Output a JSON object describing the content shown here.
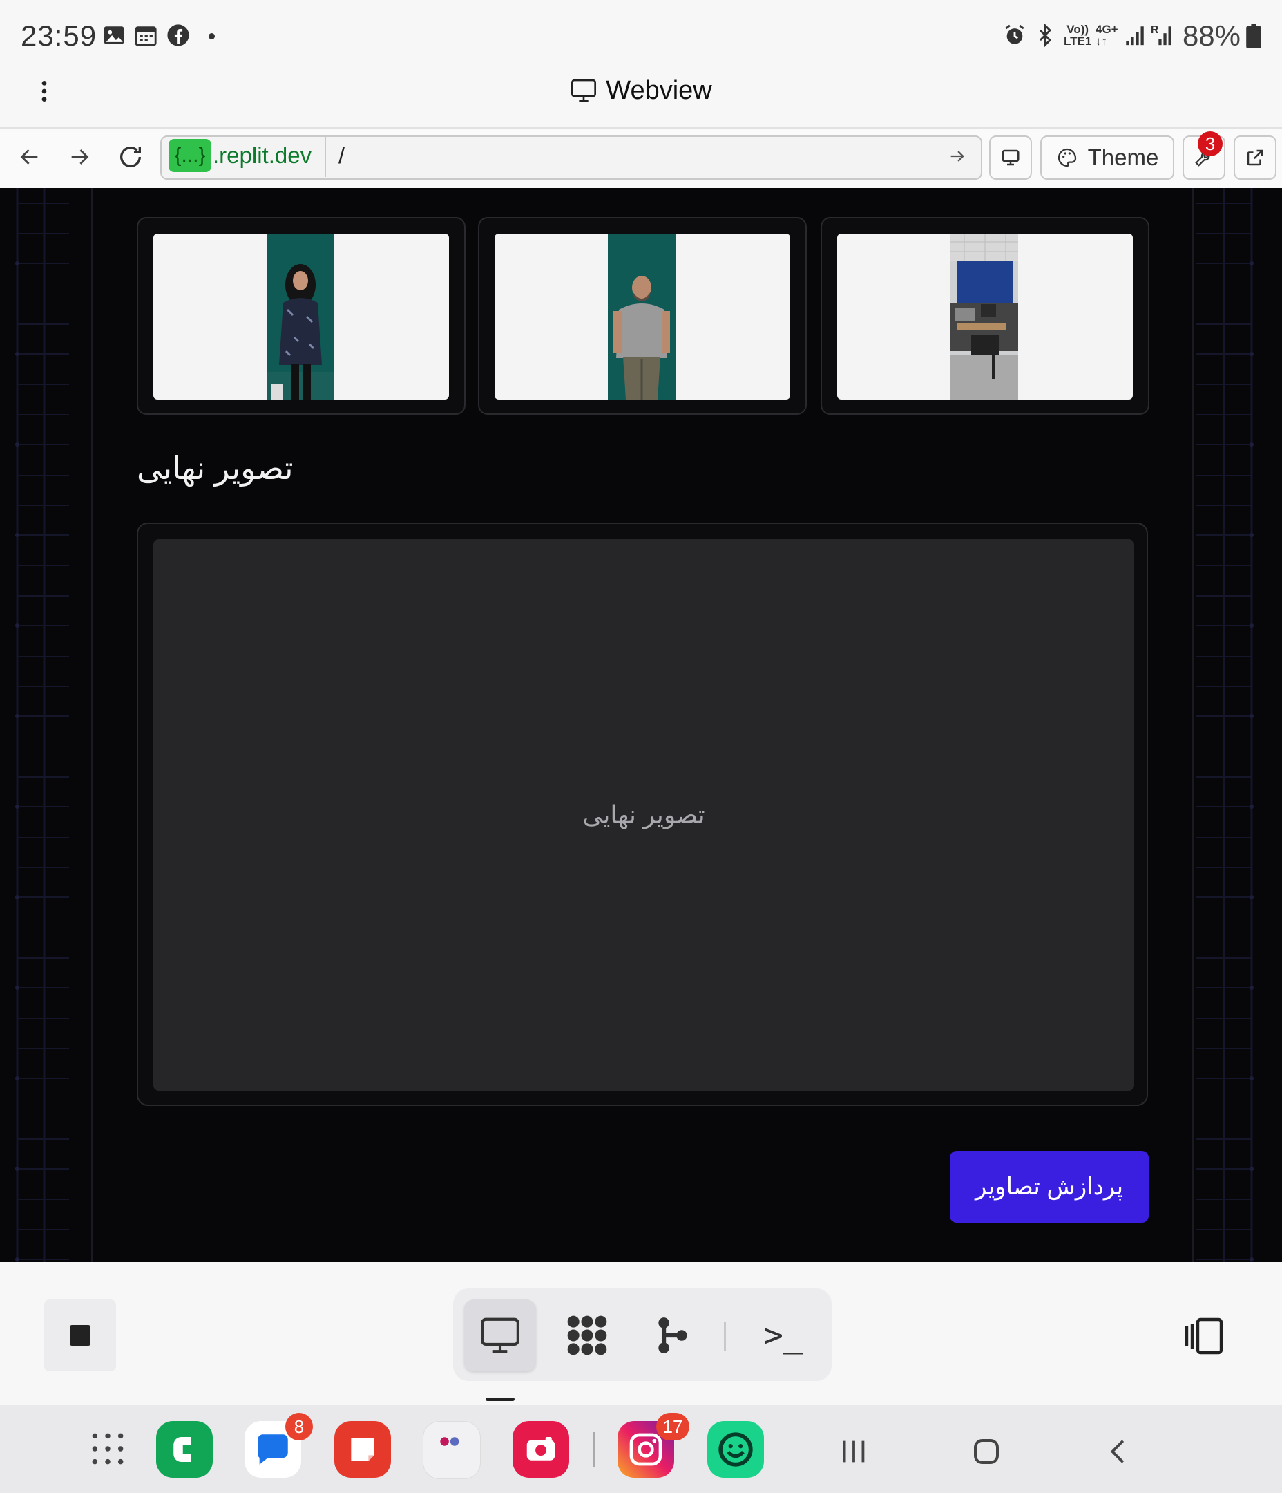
{
  "status_bar": {
    "time": "23:59",
    "battery": "88%",
    "left_icons": [
      "gallery-icon",
      "calendar-icon",
      "facebook-icon",
      "dot-icon"
    ],
    "right_icons": [
      "alarm-icon",
      "bluetooth-icon",
      "volte-icon",
      "4g-icon",
      "signal-icon",
      "signal-roaming-icon",
      "battery-icon"
    ],
    "volte_top": "Vo))",
    "volte_bottom": "LTE1",
    "net_type": "4G+",
    "roaming_mark": "R"
  },
  "title_bar": {
    "title": "Webview",
    "menu_icon": "more-vert-icon",
    "title_icon": "monitor-icon"
  },
  "url_bar": {
    "repl_tag": "{...}",
    "domain": ".replit.dev",
    "path": "/",
    "theme_label": "Theme",
    "devtools_badge": "3"
  },
  "page": {
    "section_title": "تصویر نهایی",
    "result_placeholder": "تصویر نهایی",
    "process_button": "پردازش تصاویر",
    "thumbnails": [
      {
        "name": "woman-portrait"
      },
      {
        "name": "man-portrait"
      },
      {
        "name": "office-photo"
      }
    ]
  },
  "bottom_toolbar": {
    "tools": [
      "webview-icon",
      "workflow-icon",
      "git-icon",
      "shell-icon"
    ],
    "shell_glyph": ">_"
  },
  "dock": {
    "apps": [
      {
        "name": "app-drawer-icon"
      },
      {
        "name": "phone-app-icon"
      },
      {
        "name": "messages-app-icon",
        "badge": "8"
      },
      {
        "name": "notes-app-icon"
      },
      {
        "name": "app-folder-icon"
      },
      {
        "name": "screen-recorder-icon"
      },
      {
        "name": "instagram-icon",
        "badge": "17"
      },
      {
        "name": "snapp-app-icon"
      }
    ]
  },
  "colors": {
    "accent_button": "#3b1fe0",
    "webview_bg": "#07070a",
    "repl_tag": "#2fc14a",
    "badge_red": "#d6131b"
  }
}
